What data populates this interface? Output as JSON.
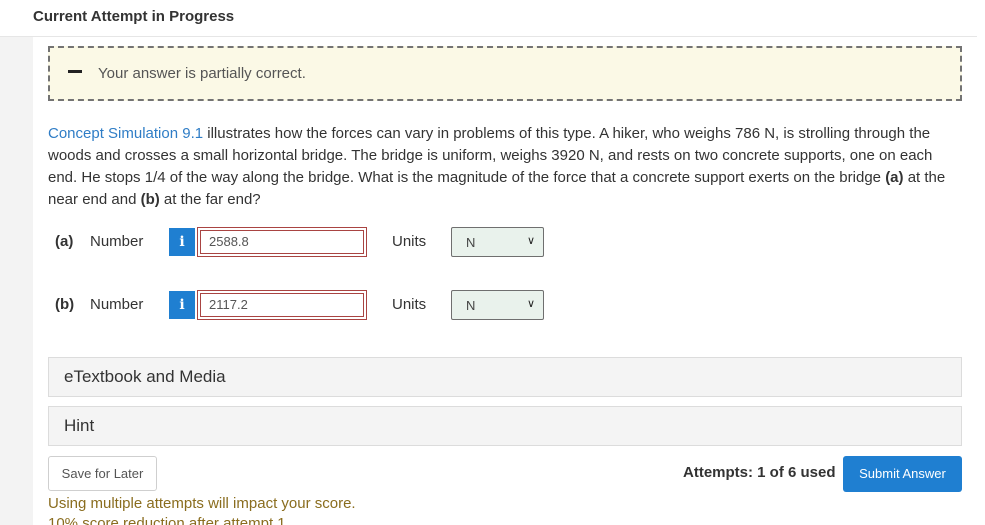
{
  "header": {
    "title": "Current Attempt in Progress"
  },
  "feedback": {
    "icon": "minus-icon",
    "text": "Your answer is partially correct."
  },
  "question": {
    "link_text": "Concept Simulation 9.1",
    "text_1": " illustrates how the forces can vary in problems of this type. A hiker, who weighs 786 N, is strolling through the woods and crosses a small horizontal bridge. The bridge is uniform, weighs 3920 N, and rests on two concrete supports, one on each end. He stops 1/4 of the way along the bridge. What is the magnitude of the force that a concrete support exerts on the bridge ",
    "part_a_bold": "(a)",
    "text_2": " at the near end and ",
    "part_b_bold": "(b)",
    "text_3": " at the far end?"
  },
  "answers": [
    {
      "label": "(a)",
      "number_label": "Number",
      "info_glyph": "i",
      "value": "2588.8",
      "units_label": "Units",
      "unit": "N"
    },
    {
      "label": "(b)",
      "number_label": "Number",
      "info_glyph": "i",
      "value": "2117.2",
      "units_label": "Units",
      "unit": "N"
    }
  ],
  "panels": {
    "etextbook": "eTextbook and Media",
    "hint": "Hint"
  },
  "footer": {
    "save_label": "Save for Later",
    "attempts": "Attempts: 1 of 6 used",
    "submit_label": "Submit Answer",
    "warning": "Using multiple attempts will impact your score.",
    "warning_2": "10% score reduction after attempt 1"
  },
  "colors": {
    "accent": "#1f7fd1",
    "link": "#2f7dc6",
    "error_border": "#a94442",
    "feedback_bg": "#fbf9e6",
    "warning_text": "#8a6d1f"
  }
}
